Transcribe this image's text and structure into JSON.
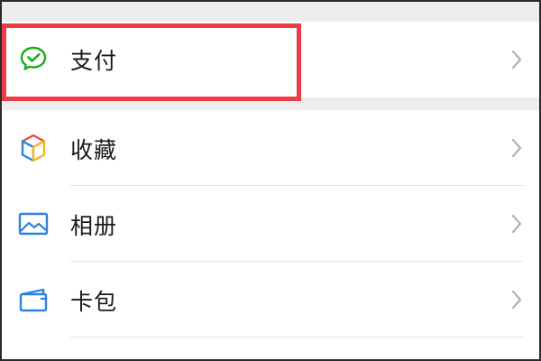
{
  "menu": {
    "pay": {
      "label": "支付",
      "icon": "wechat-pay-icon",
      "icon_color": "#1aad19"
    },
    "items": [
      {
        "label": "收藏",
        "icon": "cube-icon"
      },
      {
        "label": "相册",
        "icon": "photo-album-icon",
        "icon_color": "#2d82e0"
      },
      {
        "label": "卡包",
        "icon": "card-wallet-icon",
        "icon_color": "#2d82e0"
      }
    ]
  },
  "highlight": {
    "color": "#ef3b47",
    "target": "支付"
  },
  "colors": {
    "background": "#ededed",
    "row": "#ffffff",
    "text": "#1a1a1a",
    "chevron": "#b2b2b2"
  }
}
